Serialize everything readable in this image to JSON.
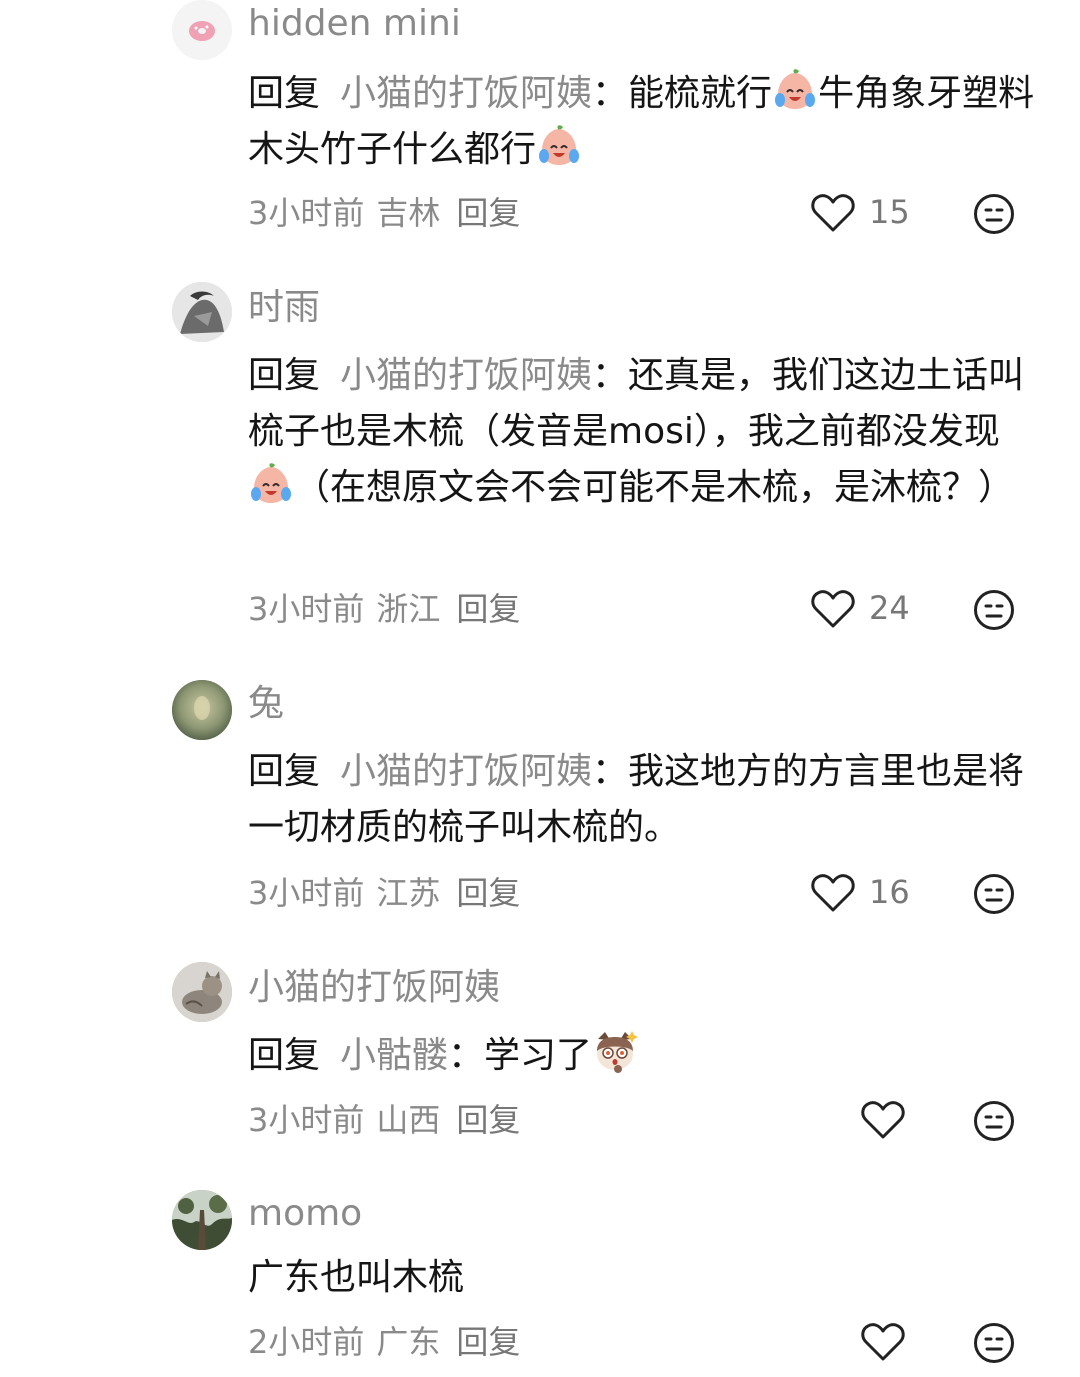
{
  "comments": [
    {
      "username": "hidden mini",
      "avatar_icon": "donut-avatar",
      "reply_keyword": "回复",
      "reply_target": "小猫的打饭阿姨",
      "colon": "：",
      "text_a": "能梳就行",
      "emoji_1": "crying-laughing-peach-emoji",
      "text_b": "牛角象牙塑料木头竹子什么都行",
      "emoji_2": "crying-laughing-peach-emoji",
      "time": "3小时前",
      "location": "吉林",
      "reply_label": "回复",
      "likes": "15"
    },
    {
      "username": "时雨",
      "avatar_icon": "sketch-avatar",
      "reply_keyword": "回复",
      "reply_target": "小猫的打饭阿姨",
      "colon": "：",
      "text_a": "还真是，我们这边土话叫梳子也是木梳（发音是mosi），我之前都没发现",
      "emoji_1": "crying-laughing-peach-emoji",
      "text_b": "（在想原文会不会可能不是木梳，是沐梳？）",
      "time": "3小时前",
      "location": "浙江",
      "reply_label": "回复",
      "likes": "24"
    },
    {
      "username": "兔",
      "avatar_icon": "blurred-photo-avatar",
      "reply_keyword": "回复",
      "reply_target": "小猫的打饭阿姨",
      "colon": "：",
      "text_a": "我这地方的方言里也是将一切材质的梳子叫木梳的。",
      "time": "3小时前",
      "location": "江苏",
      "reply_label": "回复",
      "likes": "16"
    },
    {
      "username": "小猫的打饭阿姨",
      "avatar_icon": "cat-photo-avatar",
      "reply_keyword": "回复",
      "reply_target": "小骷髅",
      "colon": "：",
      "text_a": "学习了",
      "emoji_1": "surprised-cat-emoji",
      "time": "3小时前",
      "location": "山西",
      "reply_label": "回复",
      "likes": ""
    },
    {
      "username": "momo",
      "avatar_icon": "tree-photo-avatar",
      "text_a": "广东也叫木梳",
      "time": "2小时前",
      "location": "广东",
      "reply_label": "回复",
      "likes": ""
    }
  ],
  "colors": {
    "username": "#8a8a8a",
    "body_text": "#151515",
    "meta_text": "#8a8a8a",
    "icon_stroke": "#222222"
  },
  "icons": {
    "like": "heart-outline-icon",
    "dislike": "neutral-face-icon"
  }
}
